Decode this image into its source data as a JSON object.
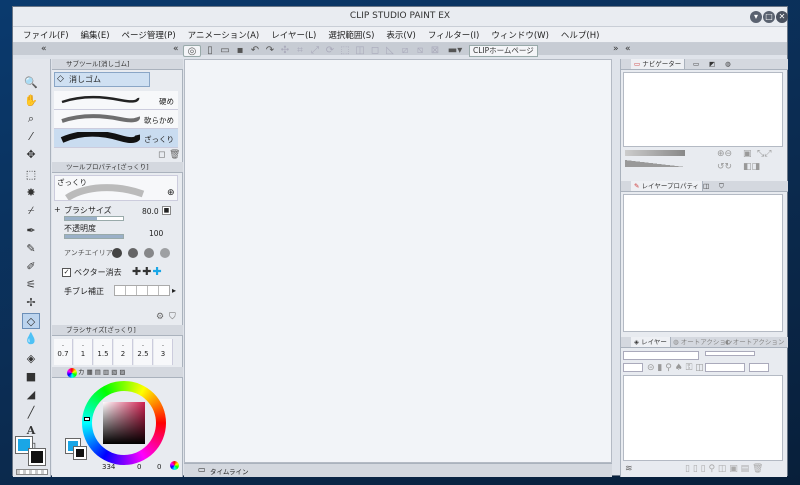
{
  "window": {
    "title": "CLIP STUDIO PAINT EX",
    "minimize": "▾",
    "maximize": "□",
    "close": "✕"
  },
  "menu": [
    "ファイル(F)",
    "編集(E)",
    "ページ管理(P)",
    "アニメーション(A)",
    "レイヤー(L)",
    "選択範囲(S)",
    "表示(V)",
    "フィルター(I)",
    "ウィンドウ(W)",
    "ヘルプ(H)"
  ],
  "toolbar": {
    "clip_home_label": "CLIPホームページ"
  },
  "subtool_panel": {
    "tab_label": "サブツール[消しゴム]",
    "group_label": "消しゴム",
    "brushes": [
      {
        "label": "硬め"
      },
      {
        "label": "軟らかめ"
      },
      {
        "label": "ざっくり"
      }
    ]
  },
  "tool_property": {
    "tab_label": "ツールプロパティ[ざっくり]",
    "preview_label": "ざっくり",
    "brush_size_label": "ブラシサイズ",
    "brush_size_value": "80.0",
    "brush_size_level": 0.55,
    "opacity_label": "不透明度",
    "opacity_value": "100",
    "opacity_level": 1.0,
    "antialias_label": "アンチエイリアス",
    "vector_erase_label": "ベクター消去",
    "stabilization_label": "手ブレ補正"
  },
  "brush_size_panel": {
    "tab_label": "ブラシサイズ[ざっくり]",
    "sizes": [
      "0.7",
      "1",
      "1.5",
      "2",
      "2.5",
      "3"
    ]
  },
  "color_panel": {
    "tab_label": "カ",
    "main_color": "#1aa6e6",
    "sub_color": "#111111",
    "readout_value": "334",
    "readout_s": "0",
    "readout_v": "0"
  },
  "navigator": {
    "tab_label": "ナビゲーター"
  },
  "layer_property": {
    "tab_label": "レイヤープロパティ"
  },
  "layer_panel": {
    "tab_label": "レイヤー",
    "tab2_label": "オートアクション",
    "tab3_label": "オートアクション"
  },
  "timeline": {
    "tab_label": "タイムライン"
  },
  "colors": {
    "accent": "#1aa6e6",
    "selection": "#bcd4ee"
  }
}
